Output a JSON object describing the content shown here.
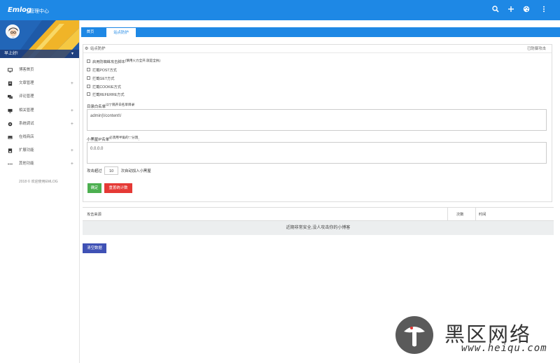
{
  "header": {
    "logo": "Emlog",
    "title": "管理中心",
    "icons": [
      "search-icon",
      "plus-icon",
      "palette-icon",
      "more-vert-icon"
    ],
    "bar_color": "#1e88e5"
  },
  "sidebar": {
    "greeting": "早上好!",
    "items": [
      {
        "label": "博客首页",
        "icon": "monitor-icon",
        "expandable": false
      },
      {
        "label": "文章管理",
        "icon": "document-icon",
        "expandable": true
      },
      {
        "label": "评论管理",
        "icon": "comments-icon",
        "expandable": false
      },
      {
        "label": "相关管理",
        "icon": "monitor-icon",
        "expandable": true
      },
      {
        "label": "系统调试",
        "icon": "gear-icon",
        "expandable": true
      },
      {
        "label": "在线商店",
        "icon": "store-icon",
        "expandable": false
      },
      {
        "label": "扩展功能",
        "icon": "extension-icon",
        "expandable": true
      },
      {
        "label": "其他功能",
        "icon": "dots-icon",
        "expandable": true
      }
    ],
    "expand_symbol": "+",
    "copyright": "2018 © 欢迎使用EMLOG"
  },
  "tabs": {
    "home": "首页",
    "active": "站点防护"
  },
  "protection_panel": {
    "title": "站点防护",
    "status": "已防御攻击",
    "options": [
      {
        "label": "启用防蜘蛛攻击脚本",
        "hint": "(慎用火力全开,就是全执)"
      },
      {
        "label": "拦截POST方式",
        "hint": ""
      },
      {
        "label": "拦截GET方式",
        "hint": ""
      },
      {
        "label": "拦截COOKIE方式",
        "hint": ""
      },
      {
        "label": "拦截REFERRE方式",
        "hint": ""
      }
    ],
    "whitelist": {
      "label": "目录白名单",
      "hint": "以\"|\"隔开白名单目录",
      "value": "admin|\\/content\\/"
    },
    "blacklist": {
      "label": "小黑屋IP名单",
      "hint": "必须用半角的\",\"分割",
      "suffix": ":",
      "value": "0.0.0.0"
    },
    "attack_rule": {
      "prefix": "攻击超过",
      "count": "10",
      "suffix": "次自动加入小黑屋"
    },
    "buttons": {
      "confirm": "确定",
      "reset": "重置统计数"
    }
  },
  "attack_table": {
    "columns": [
      "攻击来源",
      "次数",
      "时间"
    ],
    "empty_message": "近期非常安全,没人攻击你的小博客"
  },
  "clear_button": "清空数据",
  "watermark": {
    "chinese": "黑区网络",
    "url": "www.heiqu.com"
  }
}
